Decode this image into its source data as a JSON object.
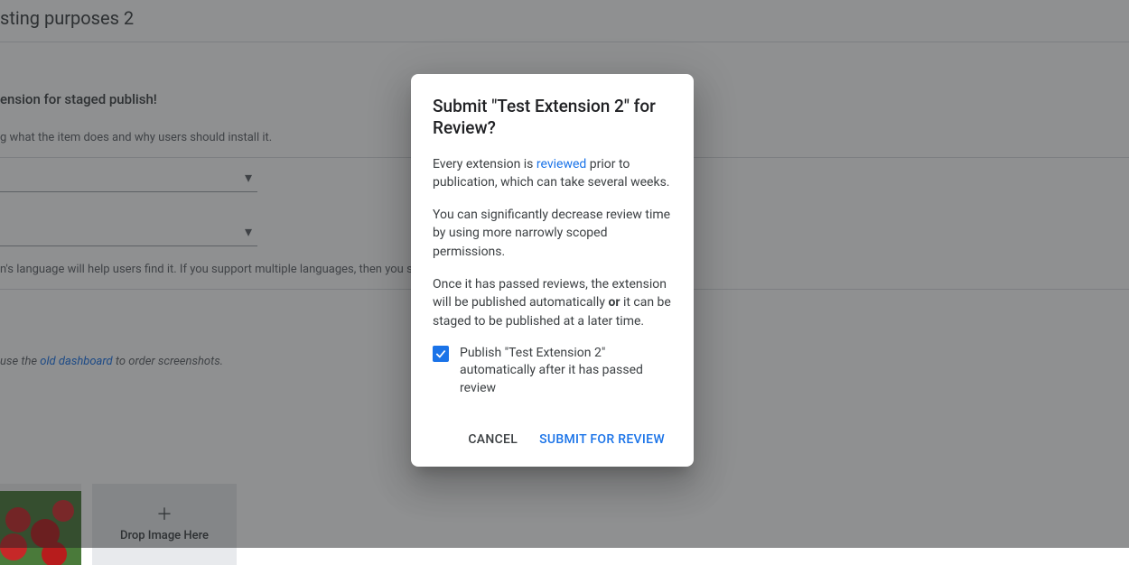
{
  "bg": {
    "title_suffix": "sting purposes 2",
    "subtitle": "ension for staged publish!",
    "description_hint": "g what the item does and why users should install it.",
    "language_hint_prefix": "n's language will help users find it. If you support multiple languages, then you sh",
    "screenshots_hint_prefix": "use the ",
    "old_dashboard_link": "old dashboard",
    "screenshots_hint_suffix": " to order screenshots.",
    "drop_label": "Drop Image Here"
  },
  "dialog": {
    "title": "Submit \"Test Extension 2\" for Review?",
    "p1_prefix": "Every extension is ",
    "p1_link": "reviewed",
    "p1_suffix": " prior to publication, which can take several weeks.",
    "p2": "You can significantly decrease review time by using more narrowly scoped permissions.",
    "p3_prefix": "Once it has passed reviews, the extension will be published automatically ",
    "p3_bold": "or",
    "p3_suffix": " it can be staged to be published at a later time.",
    "checkbox_label": "Publish \"Test Extension 2\" automatically after it has passed review",
    "cancel_label": "Cancel",
    "submit_label": "Submit for Review"
  }
}
